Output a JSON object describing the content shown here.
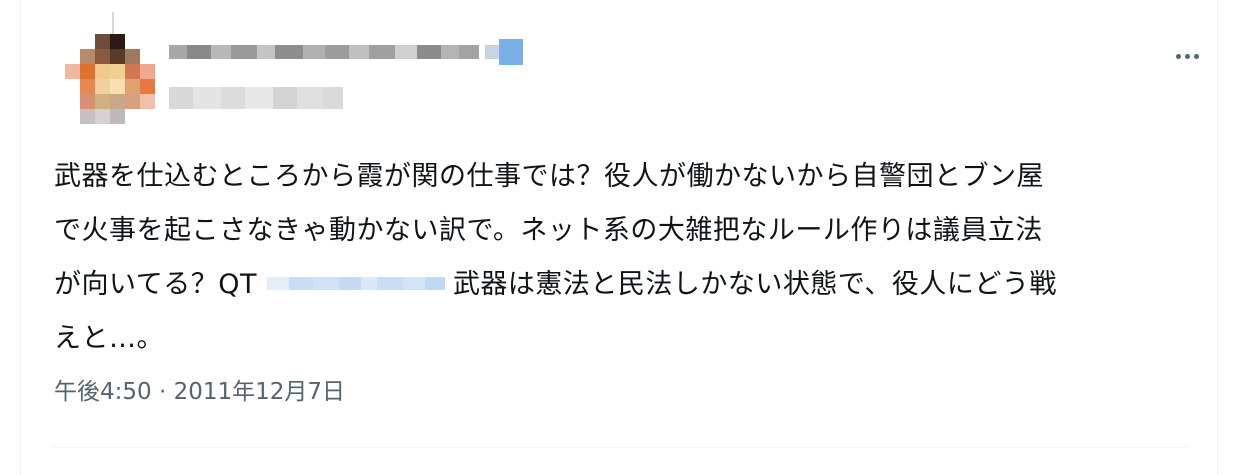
{
  "tweet": {
    "text_lines": [
      "武器を仕込むところから霞が関の仕事では？役人が働かないから自警団とブン屋",
      "で火事を起こさなきゃ動かない訳で。ネット系の大雑把なルール作りは議員立法",
      "が向いてる？QT",
      "武器は憲法と民法しかない状態で、役人にどう戦",
      "えと…。"
    ],
    "timestamp": "午後4:50 · 2011年12月7日"
  },
  "icons": {
    "more": "more-horizontal-icon",
    "avatar": "avatar-image"
  },
  "colors": {
    "text": "#0f1419",
    "secondary": "#536471",
    "divider": "#eff3f4",
    "mention": "#1d9bf0"
  }
}
